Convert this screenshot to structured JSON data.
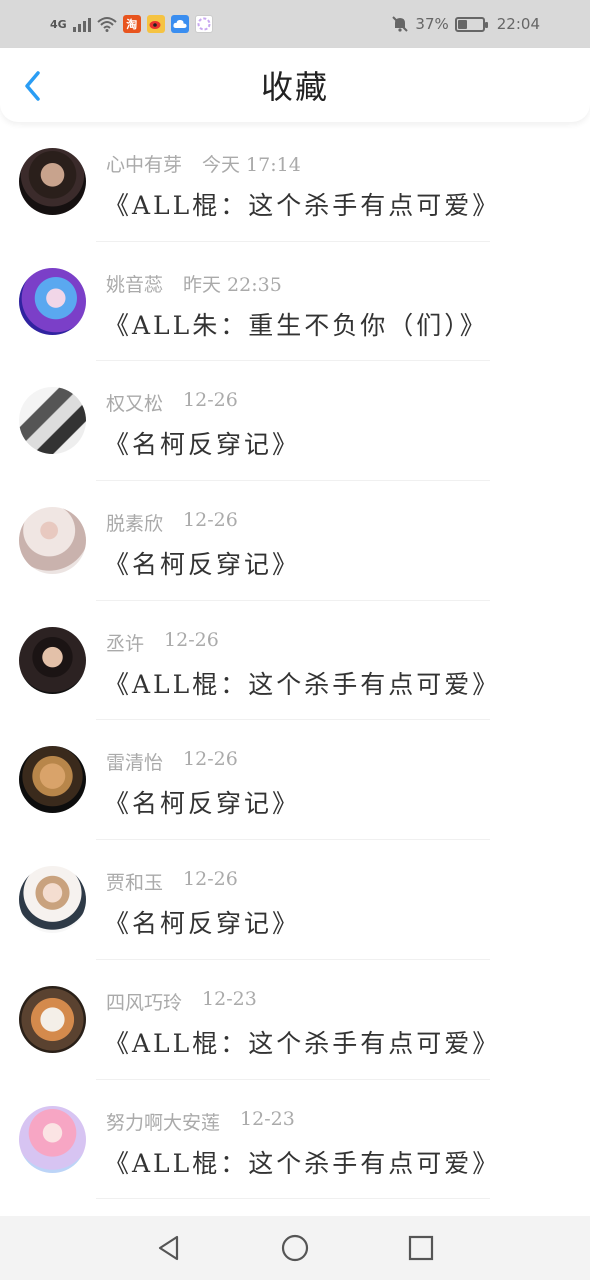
{
  "status_bar": {
    "network": "4G",
    "battery": "37%",
    "time": "22:04",
    "battery_level": 0.37,
    "apps": [
      {
        "icon": "taobao-icon",
        "label": "淘",
        "color": "#e8541e"
      },
      {
        "icon": "weibo-icon",
        "label": "",
        "color": "#f5c342"
      },
      {
        "icon": "cloud-icon",
        "label": "",
        "color": "#3a8ef0"
      },
      {
        "icon": "circle-app-icon",
        "label": "",
        "color": "#c8a8f0"
      }
    ]
  },
  "header": {
    "title": "收藏",
    "accent": "#2a9df4"
  },
  "items": [
    {
      "user": "心中有芽",
      "time": "今天 17:14",
      "book": "《ALL棍：这个杀手有点可爱》"
    },
    {
      "user": "姚音蕊",
      "time": "昨天 22:35",
      "book": "《ALL朱：重生不负你（们）》"
    },
    {
      "user": "权又松",
      "time": "12-26",
      "book": "《名柯反穿记》"
    },
    {
      "user": "脱素欣",
      "time": "12-26",
      "book": "《名柯反穿记》"
    },
    {
      "user": "丞许",
      "time": "12-26",
      "book": "《ALL棍：这个杀手有点可爱》"
    },
    {
      "user": "雷清怡",
      "time": "12-26",
      "book": "《名柯反穿记》"
    },
    {
      "user": "贾和玉",
      "time": "12-26",
      "book": "《名柯反穿记》"
    },
    {
      "user": "四风巧玲",
      "time": "12-23",
      "book": "《ALL棍：这个杀手有点可爱》"
    },
    {
      "user": "努力啊大安莲",
      "time": "12-23",
      "book": "《ALL棍：这个杀手有点可爱》"
    }
  ],
  "nav": {
    "buttons": [
      "back-triangle-icon",
      "home-circle-icon",
      "recents-square-icon"
    ]
  }
}
